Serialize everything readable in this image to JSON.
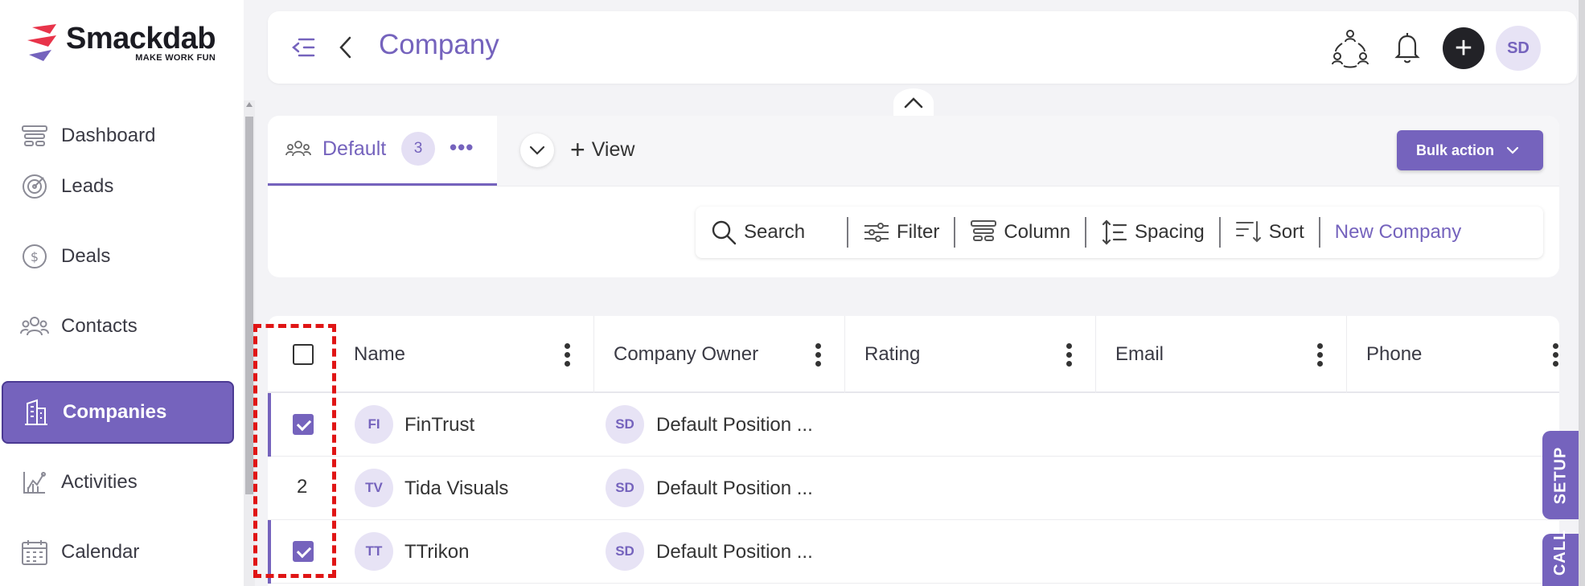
{
  "brand": {
    "name": "Smackdab",
    "tagline": "MAKE WORK FUN"
  },
  "sidebar": {
    "items": [
      {
        "label": "Dashboard",
        "icon": "dashboard-icon"
      },
      {
        "label": "Leads",
        "icon": "target-icon"
      },
      {
        "label": "Deals",
        "icon": "dollar-icon"
      },
      {
        "label": "Contacts",
        "icon": "contacts-icon"
      },
      {
        "label": "Companies",
        "icon": "building-icon",
        "active": true
      },
      {
        "label": "Activities",
        "icon": "activities-icon"
      },
      {
        "label": "Calendar",
        "icon": "calendar-icon"
      }
    ]
  },
  "header": {
    "title": "Company",
    "avatar_initials": "SD",
    "add_label": "+"
  },
  "views": {
    "default_tab_label": "Default",
    "default_tab_count": "3",
    "more_label": "•••",
    "add_view_label": "View",
    "bulk_action_label": "Bulk action"
  },
  "toolbar": {
    "search_label": "Search",
    "filter_label": "Filter",
    "column_label": "Column",
    "spacing_label": "Spacing",
    "sort_label": "Sort",
    "new_label": "New Company"
  },
  "table": {
    "columns": [
      "Name",
      "Company Owner",
      "Rating",
      "Email",
      "Phone"
    ],
    "rows": [
      {
        "selector": "checked",
        "initials": "FI",
        "name": "FinTrust",
        "owner_initials": "SD",
        "owner": "Default Position ..."
      },
      {
        "selector": "2",
        "initials": "TV",
        "name": "Tida Visuals",
        "owner_initials": "SD",
        "owner": "Default Position ..."
      },
      {
        "selector": "checked",
        "initials": "TT",
        "name": "TTrikon",
        "owner_initials": "SD",
        "owner": "Default Position ..."
      }
    ]
  },
  "side_tabs": {
    "setup_label": "SETUP",
    "call_label": "CALL"
  },
  "colors": {
    "accent": "#7563bd",
    "accent_dark": "#4b3a93",
    "highlight": "#e01515"
  }
}
